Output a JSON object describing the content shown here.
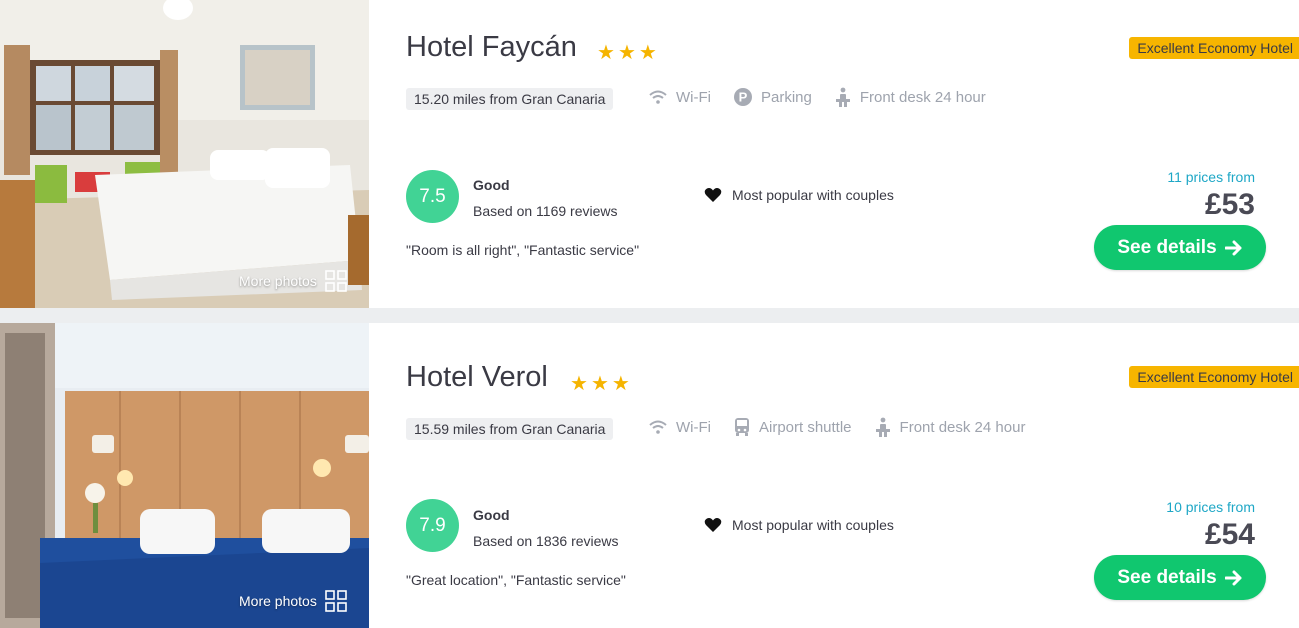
{
  "hotels": [
    {
      "name": "Hotel Faycán",
      "badge": "Excellent Economy Hotel",
      "distance": "15.20 miles from Gran Canaria",
      "amenities": [
        "Wi-Fi",
        "Parking",
        "Front desk 24 hour"
      ],
      "amenity_icons": [
        "wifi-icon",
        "parking-icon",
        "front-desk-icon"
      ],
      "score": "7.5",
      "rating_label": "Good",
      "reviews": "Based on 1169 reviews",
      "quote": "\"Room is all right\", \"Fantastic service\"",
      "popular": "Most popular with couples",
      "prices_from": "11 prices from",
      "price": "£53",
      "cta": "See details",
      "more_photos": "More photos",
      "stars": 3
    },
    {
      "name": "Hotel Verol",
      "badge": "Excellent Economy Hotel",
      "distance": "15.59 miles from Gran Canaria",
      "amenities": [
        "Wi-Fi",
        "Airport shuttle",
        "Front desk 24 hour"
      ],
      "amenity_icons": [
        "wifi-icon",
        "bus-icon",
        "front-desk-icon"
      ],
      "score": "7.9",
      "rating_label": "Good",
      "reviews": "Based on 1836 reviews",
      "quote": "\"Great location\", \"Fantastic service\"",
      "popular": "Most popular with couples",
      "prices_from": "10 prices from",
      "price": "£54",
      "cta": "See details",
      "more_photos": "More photos",
      "stars": 3
    }
  ],
  "colors": {
    "score_green": "#41d395",
    "cta_green": "#10c76f",
    "badge_yellow": "#f7b500",
    "star_yellow": "#f5b400",
    "price_link_blue": "#1ea7c6"
  }
}
